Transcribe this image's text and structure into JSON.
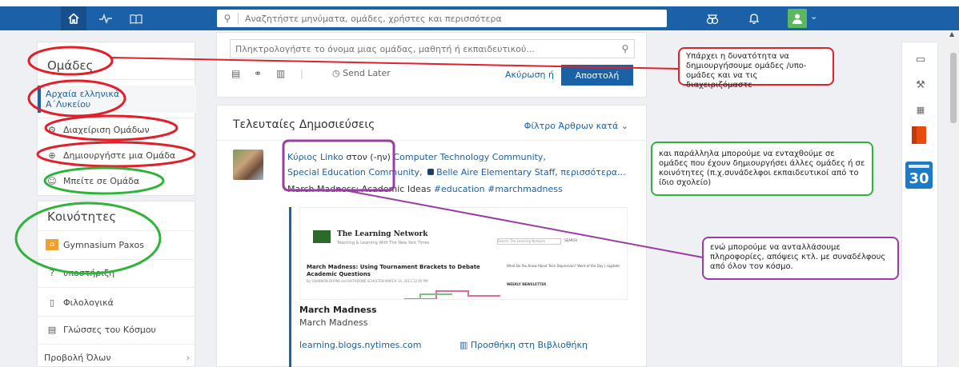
{
  "navbar": {
    "search_placeholder": "Αναζητήστε μηνύματα, ομάδες, χρήστες και περισσότερα"
  },
  "sidebar": {
    "groups_title": "Ομάδες",
    "group_item_line1": "Αρχαία ελληνικά",
    "group_item_line2": "Α΄Λυκείου",
    "manage_groups": "Διαχείριση Ομάδων",
    "create_group": "Δημιουργήστε μια Ομάδα",
    "join_group": "Μπείτε σε Ομάδα",
    "communities_title": "Κοινότητες",
    "communities": [
      {
        "label": "Gymnasium Paxos"
      },
      {
        "label": "υποστήριξη"
      },
      {
        "label": "Φιλολογικά"
      },
      {
        "label": "Γλώσσες του Κόσμου"
      }
    ],
    "view_all": "Προβολή Όλων"
  },
  "compose": {
    "placeholder": "Πληκτρολογήστε το όνομα μιας ομάδας, μαθητή ή εκπαιδευτικού...",
    "send_later": "Send Later",
    "cancel": "Ακύρωση ή",
    "send": "Αποστολή"
  },
  "posts": {
    "title": "Τελευταίες Δημοσιεύσεις",
    "filter": "Φίλτρο Άρθρων κατά",
    "post": {
      "author": "Κύριος Linko",
      "to_word": "στον (-ην)",
      "community1": "Computer Technology Community,",
      "community2": "Special Education Community,",
      "community3": "Belle Aire Elementary Staff,",
      "more": "περισσότερα...",
      "message": "March Madness: Academic Ideas",
      "tag1": "#education",
      "tag2": "#marchmadness"
    },
    "embed": {
      "site_name": "The Learning Network",
      "site_sub": "Teaching & Learning With The New York Times",
      "search_placeholder": "Search The Learning Network",
      "search_btn": "SEARCH",
      "headline": "March Madness: Using Tournament Brackets to Debate Academic Questions",
      "byline": "By SHANNON DOYNE and KATHERINE SCHULTEN   MARCH 14, 2013 12:00 PM",
      "side_text": "What Do You Know About Teen Depression?   Word of the Day | cogitate",
      "newsletter": "WEEKLY NEWSLETTER",
      "title": "March Madness",
      "description": "March Madness",
      "link": "learning.blogs.nytimes.com",
      "add_library": "Προσθήκη στη Βιβλιοθήκη"
    }
  },
  "annotations": {
    "red": "Υπάρχει η δυνατότητα να δημιουργήσουμε ομάδες /υπο-ομάδες και να τις διαχειριζόμαστε",
    "green": "και παράλληλα μπορούμε να ενταχθούμε σε ομάδες που έχουν δημιουργήσει άλλες ομάδες ή σε κοινότητες (π.χ.συνάδελφοι εκπαιδευτικοί από το ίδιο σχολείο)",
    "purple": "ενώ μπορούμε να ανταλλάσουμε πληροφορίες, απόψεις κτλ. με συναδέλφους από όλον τον κόσμο."
  },
  "rail": {
    "calendar_day": "30"
  },
  "colors": {
    "navbar": "#1b61a8",
    "accent": "#1b61a8",
    "annot_red": "#e0202a",
    "annot_green": "#2fb33a",
    "annot_purple": "#9b3ca3"
  }
}
